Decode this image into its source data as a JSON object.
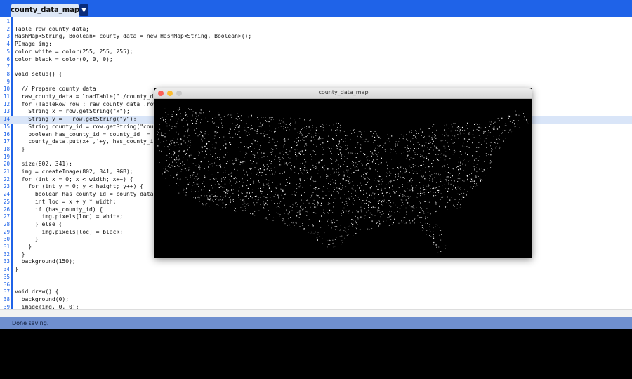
{
  "tab": {
    "title": "county_data_map",
    "menu_glyph": "▼"
  },
  "editor": {
    "highlight_line": 14,
    "lines": [
      {
        "n": "1",
        "t": ""
      },
      {
        "n": "2",
        "t": "Table raw_county_data;"
      },
      {
        "n": "3",
        "t": "HashMap<String, Boolean> county_data = new HashMap<String, Boolean>();"
      },
      {
        "n": "4",
        "t": "PImage img;"
      },
      {
        "n": "5",
        "t": "color white = color(255, 255, 255);"
      },
      {
        "n": "6",
        "t": "color black = color(0, 0, 0);"
      },
      {
        "n": "7",
        "t": ""
      },
      {
        "n": "8",
        "t": "void setup() {"
      },
      {
        "n": "9",
        "t": ""
      },
      {
        "n": "10",
        "t": "  // Prepare county data"
      },
      {
        "n": "11",
        "t": "  raw_county_data = loadTable(\"./county_dat"
      },
      {
        "n": "12",
        "t": "  for (TableRow row : raw_county_data .rows"
      },
      {
        "n": "13",
        "t": "    String x = row.getString(\"x\");"
      },
      {
        "n": "14",
        "t": "    String y =   row.getString(\"y\");"
      },
      {
        "n": "15",
        "t": "    String county_id = row.getString(\"count"
      },
      {
        "n": "16",
        "t": "    boolean has_county_id = county_id != \""
      },
      {
        "n": "17",
        "t": "    county_data.put(x+','+y, has_county_id)"
      },
      {
        "n": "18",
        "t": "  }"
      },
      {
        "n": "19",
        "t": ""
      },
      {
        "n": "20",
        "t": "  size(802, 341);"
      },
      {
        "n": "21",
        "t": "  img = createImage(802, 341, RGB);"
      },
      {
        "n": "22",
        "t": "  for (int x = 0; x < width; x++) {"
      },
      {
        "n": "23",
        "t": "    for (int y = 0; y < height; y++) {"
      },
      {
        "n": "24",
        "t": "      boolean has_county_id = county_data.g"
      },
      {
        "n": "25",
        "t": "      int loc = x + y * width;"
      },
      {
        "n": "26",
        "t": "      if (has_county_id) {"
      },
      {
        "n": "27",
        "t": "        img.pixels[loc] = white;"
      },
      {
        "n": "28",
        "t": "      } else {"
      },
      {
        "n": "29",
        "t": "        img.pixels[loc] = black;"
      },
      {
        "n": "30",
        "t": "      }"
      },
      {
        "n": "31",
        "t": "    }"
      },
      {
        "n": "32",
        "t": "  }"
      },
      {
        "n": "33",
        "t": "  background(150);"
      },
      {
        "n": "34",
        "t": "}"
      },
      {
        "n": "35",
        "t": ""
      },
      {
        "n": "36",
        "t": ""
      },
      {
        "n": "37",
        "t": "void draw() {"
      },
      {
        "n": "38",
        "t": "  background(0);"
      },
      {
        "n": "39",
        "t": "  image(img, 0, 0);"
      }
    ]
  },
  "status": {
    "message": "Done saving."
  },
  "sketch_window": {
    "title": "county_data_map",
    "buttons": [
      {
        "name": "close",
        "color": "#fc5f57"
      },
      {
        "name": "minimize",
        "color": "#fdbc2e"
      },
      {
        "name": "zoom",
        "color": "#c8c8c8"
      }
    ],
    "map": {
      "background": "#000000",
      "dot_color": "#ffffff",
      "shape": "dotted-map-of-united-states"
    }
  },
  "colors": {
    "accent": "#1f63e8",
    "status_bar": "#6f8fcf",
    "line_highlight": "#d9e5f8"
  }
}
